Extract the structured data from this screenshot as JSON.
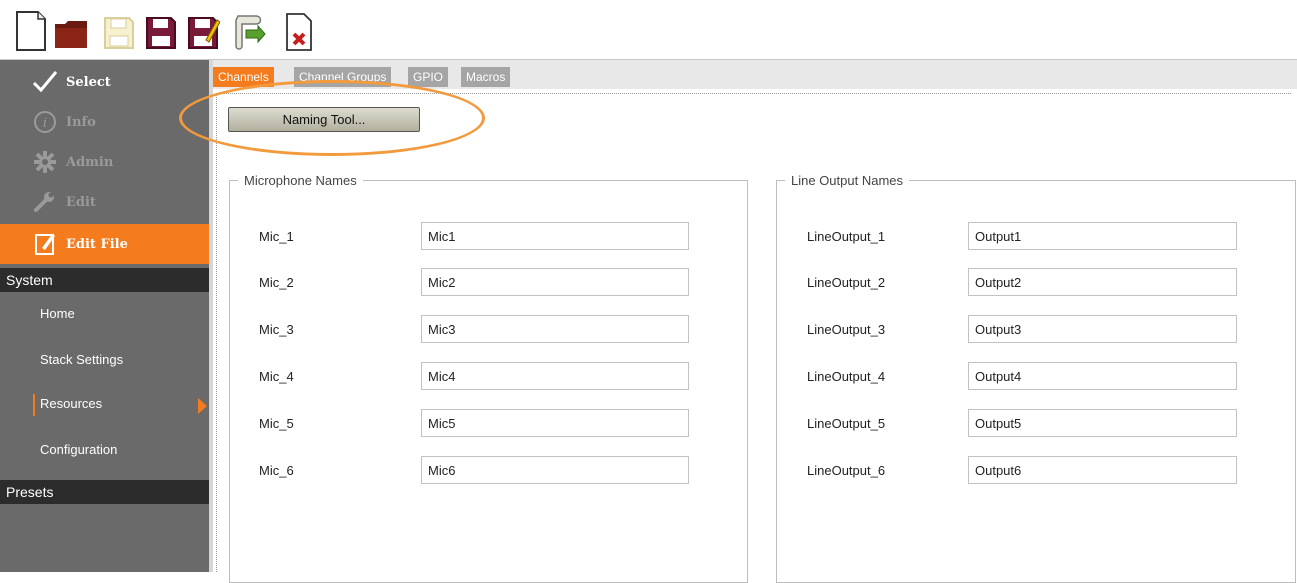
{
  "toolbar": {
    "buttons": [
      {
        "name": "new-file-icon",
        "title": "New"
      },
      {
        "name": "open-folder-icon",
        "title": "Open"
      },
      {
        "name": "save-disabled-icon",
        "title": "Save"
      },
      {
        "name": "save-icon",
        "title": "Save"
      },
      {
        "name": "save-as-icon",
        "title": "Save As"
      },
      {
        "name": "deploy-icon",
        "title": "Send"
      },
      {
        "name": "close-file-icon",
        "title": "Close"
      }
    ]
  },
  "sidebar": {
    "modes": [
      {
        "label": "Select",
        "icon": "checkmark-icon",
        "state": "on"
      },
      {
        "label": "Info",
        "icon": "info-icon",
        "state": "off"
      },
      {
        "label": "Admin",
        "icon": "gear-icon",
        "state": "off"
      },
      {
        "label": "Edit",
        "icon": "wrench-icon",
        "state": "off"
      },
      {
        "label": "Edit File",
        "icon": "edit-file-icon",
        "state": "active"
      }
    ],
    "system_header": "System",
    "system_items": [
      {
        "label": "Home"
      },
      {
        "label": "Stack Settings"
      },
      {
        "label": "Resources"
      },
      {
        "label": "Configuration"
      }
    ],
    "presets_header": "Presets"
  },
  "tabs": [
    {
      "label": "Channels",
      "active": true
    },
    {
      "label": "Channel Groups",
      "active": false
    },
    {
      "label": "GPIO",
      "active": false
    },
    {
      "label": "Macros",
      "active": false
    }
  ],
  "naming_tool": {
    "label": "Naming Tool..."
  },
  "mic_group": {
    "title": "Microphone Names",
    "rows": [
      {
        "label": "Mic_1",
        "value": "Mic1"
      },
      {
        "label": "Mic_2",
        "value": "Mic2"
      },
      {
        "label": "Mic_3",
        "value": "Mic3"
      },
      {
        "label": "Mic_4",
        "value": "Mic4"
      },
      {
        "label": "Mic_5",
        "value": "Mic5"
      },
      {
        "label": "Mic_6",
        "value": "Mic6"
      }
    ]
  },
  "line_group": {
    "title": "Line Output Names",
    "rows": [
      {
        "label": "LineOutput_1",
        "value": "Output1"
      },
      {
        "label": "LineOutput_2",
        "value": "Output2"
      },
      {
        "label": "LineOutput_3",
        "value": "Output3"
      },
      {
        "label": "LineOutput_4",
        "value": "Output4"
      },
      {
        "label": "LineOutput_5",
        "value": "Output5"
      },
      {
        "label": "LineOutput_6",
        "value": "Output6"
      }
    ]
  },
  "colors": {
    "accent": "#f47b1e",
    "sidebar": "#6a6a6a",
    "header": "#2c2c2c",
    "highlight": "#f29a3c"
  }
}
